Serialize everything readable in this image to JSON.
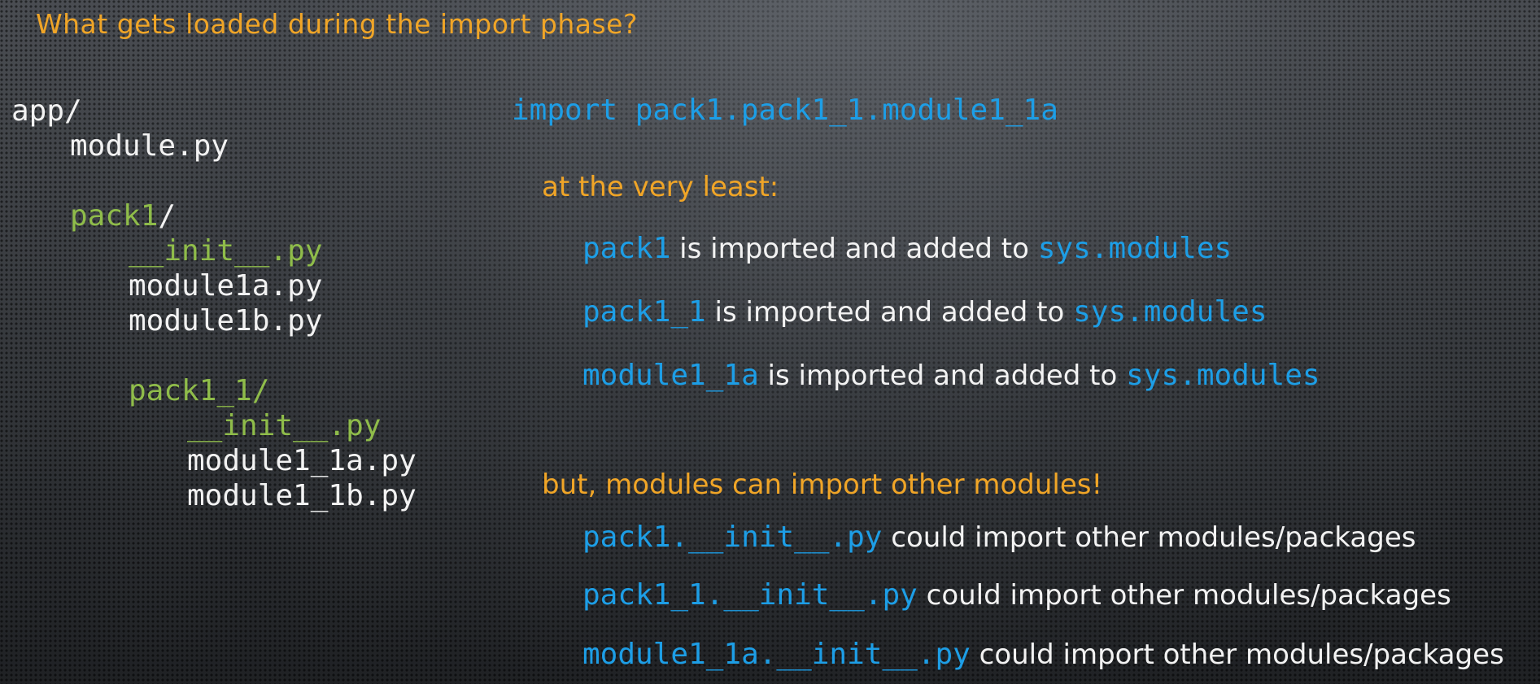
{
  "slide": {
    "title": "What gets loaded during the import phase?"
  },
  "tree": {
    "root": "app/",
    "module": "module.py",
    "pack1": "pack1",
    "pack1_slash": "/",
    "pack1_init": "__init__.py",
    "module1a": "module1a.py",
    "module1b": "module1b.py",
    "pack1_1": "pack1_1/",
    "pack1_1_init": "__init__.py",
    "module1_1a": "module1_1a.py",
    "module1_1b": "module1_1b.py"
  },
  "statement": "import pack1.pack1_1.module1_1a",
  "least": {
    "heading": "at the very least:",
    "items": [
      {
        "code": "pack1",
        "text": " is imported and added to ",
        "target": "sys.modules"
      },
      {
        "code": "pack1_1",
        "text": " is imported and added to ",
        "target": "sys.modules"
      },
      {
        "code": "module1_1a",
        "text": " is imported and added to ",
        "target": "sys.modules"
      }
    ]
  },
  "but": {
    "heading": "but, modules can import other modules!",
    "items": [
      {
        "code": "pack1.__init__.py",
        "text": " could import other modules/packages"
      },
      {
        "code": "pack1_1.__init__.py",
        "text": " could import other modules/packages"
      },
      {
        "code": "module1_1a.__init__.py",
        "text": " could import other modules/packages"
      }
    ]
  },
  "colors": {
    "title": "#f0a527",
    "code": "#1d9ee6",
    "package": "#8fbc4a",
    "text": "#f2f2f2"
  }
}
